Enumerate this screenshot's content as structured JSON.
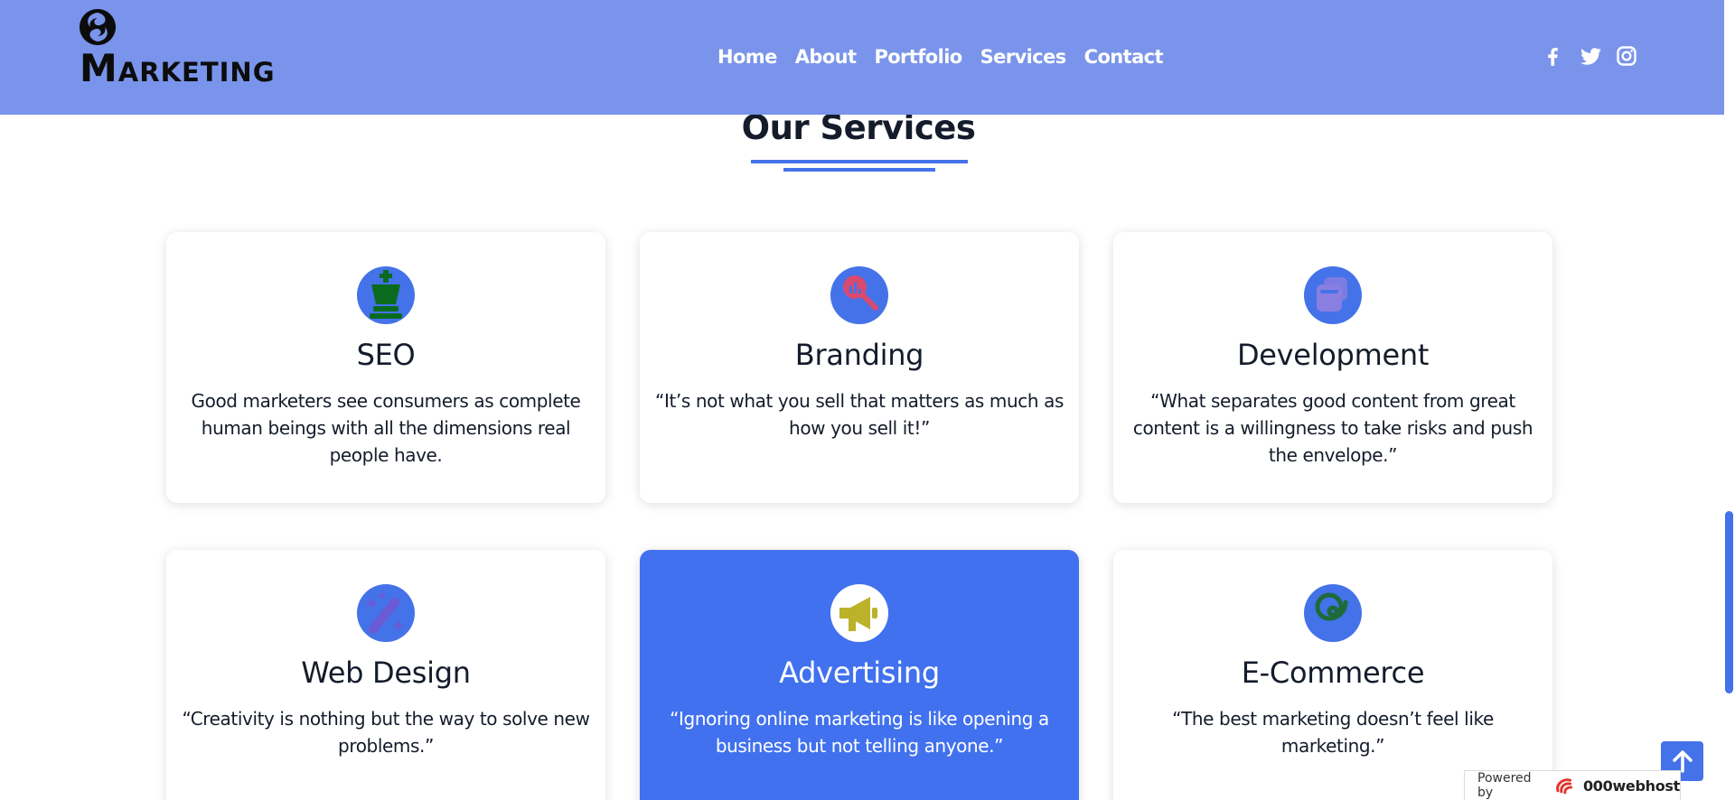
{
  "brand": {
    "name": "Marketing"
  },
  "nav": [
    {
      "label": "Home"
    },
    {
      "label": "About"
    },
    {
      "label": "Portfolio"
    },
    {
      "label": "Services"
    },
    {
      "label": "Contact"
    }
  ],
  "social": [
    "facebook-icon",
    "twitter-icon",
    "instagram-icon"
  ],
  "section": {
    "title": "Our Services"
  },
  "services": [
    {
      "title": "SEO",
      "text": "Good marketers see consumers as complete human beings with all the dimensions real people have.",
      "icon": "chess-king-icon"
    },
    {
      "title": "Branding",
      "text": "“It’s not what you sell that matters as much as how you sell it!”",
      "icon": "magnifier-chart-icon"
    },
    {
      "title": "Development",
      "text": "“What separates good content from great content is a willingness to take risks and push the envelope.”",
      "icon": "windows-icon"
    },
    {
      "title": "Web Design",
      "text": "“Creativity is nothing but the way to solve new problems.”",
      "icon": "magic-wand-icon"
    },
    {
      "title": "Advertising",
      "text": "“Ignoring online marketing is like opening a business but not telling anyone.”",
      "icon": "megaphone-icon"
    },
    {
      "title": "E-Commerce",
      "text": "“The best marketing doesn’t feel like marketing.”",
      "icon": "spiral-icon"
    }
  ],
  "footer": {
    "powered_label": "Powered by",
    "powered_brand": "000webhost"
  },
  "colors": {
    "header": "#7994ea",
    "accent": "#4472e8",
    "active_card": "#4171ee",
    "text": "#141c2b"
  }
}
